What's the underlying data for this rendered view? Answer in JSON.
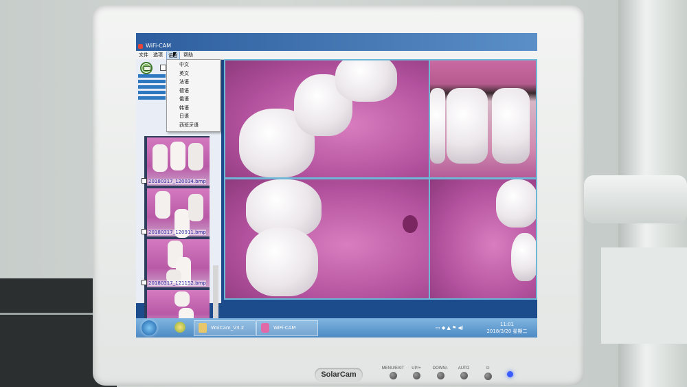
{
  "window": {
    "title": "WiFi-CAM"
  },
  "menu": {
    "items": [
      "文件",
      "选项",
      "语言",
      "帮助"
    ],
    "active_index": 2
  },
  "language_menu": {
    "items": [
      "中文",
      "英文",
      "法语",
      "德语",
      "俄语",
      "韩语",
      "日语",
      "西班牙语"
    ]
  },
  "thumbnails": [
    {
      "caption": "20180317_120034.bmp",
      "checked": true
    },
    {
      "caption": "20180317_120911.bmp",
      "checked": true
    },
    {
      "caption": "20180317_121152.bmp",
      "checked": true
    }
  ],
  "taskbar": {
    "tasks": [
      {
        "label": "WoiCam_V3.2",
        "icon": "folder-icon"
      },
      {
        "label": "WiFi-CAM",
        "icon": "camera-app-icon"
      }
    ],
    "time": "11:01",
    "date": "2018/3/20 星期二"
  },
  "monitor": {
    "brand": "SolarCam",
    "buttons": [
      "MENU/EXIT",
      "UP/+",
      "DOWN/-",
      "AUTO",
      "⏻"
    ]
  },
  "colors": {
    "titlebar": "#2d5d9e",
    "taskbar": "#4e8ac4",
    "oral_tissue": "#c35fad",
    "video_grid": "#6fb7d6"
  }
}
